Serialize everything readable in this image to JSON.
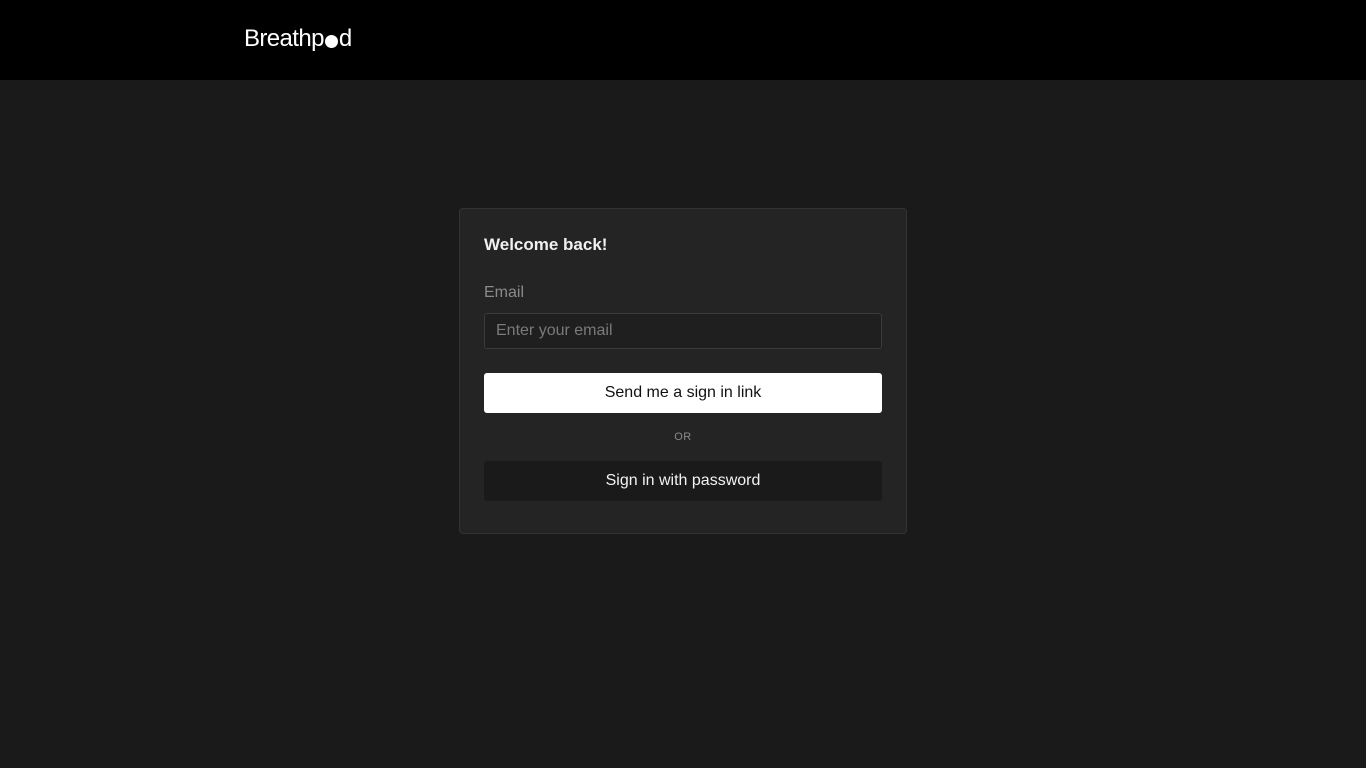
{
  "header": {
    "logo_prefix": "Breathp",
    "logo_suffix": "d"
  },
  "login": {
    "title": "Welcome back!",
    "email_label": "Email",
    "email_placeholder": "Enter your email",
    "email_value": "",
    "send_link_label": "Send me a sign in link",
    "or_label": "OR",
    "password_label": "Sign in with password"
  },
  "colors": {
    "page_background": "#1a1a1a",
    "header_background": "#000000",
    "card_background": "#242424",
    "primary_button": "#ffffff",
    "secondary_button": "#1a1a1a"
  }
}
